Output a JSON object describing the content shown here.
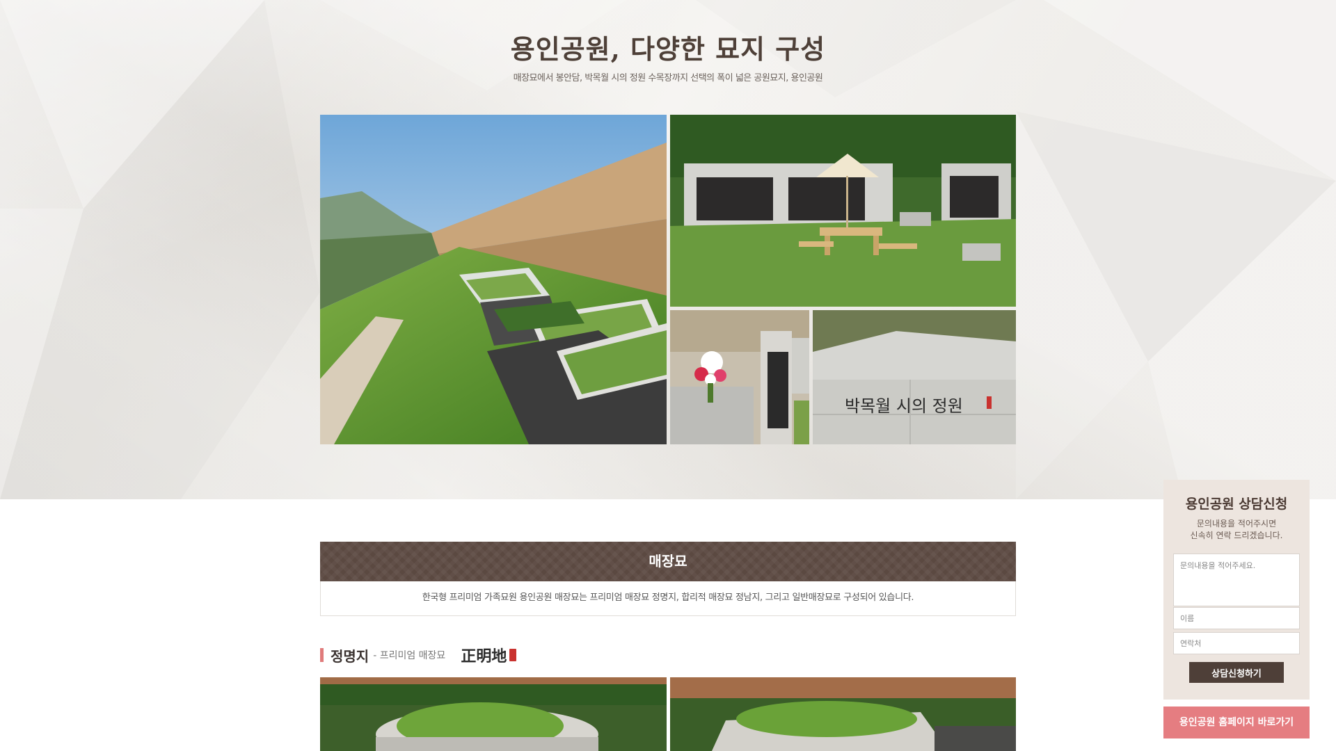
{
  "hero": {
    "title": "용인공원, 다양한 묘지 구성",
    "subtitle": "매장묘에서 봉안담, 박목월 시의 정원 수목장까지 선택의 폭이 넓은 공원묘지, 용인공원",
    "photos": [
      {
        "name": "photo-terraced-graves",
        "caption": ""
      },
      {
        "name": "photo-pavilion-picnic",
        "caption": ""
      },
      {
        "name": "photo-flower-memorial",
        "caption": ""
      },
      {
        "name": "photo-poet-garden-stone",
        "caption": "박목월 시의 정원"
      }
    ]
  },
  "section": {
    "title": "매장묘",
    "description": "한국형 프리미엄 가족묘원 용인공원 매장묘는 프리미엄 매장묘 정명지, 합리적 매장묘 정남지, 그리고 일반매장묘로 구성되어 있습니다.",
    "sub": {
      "title": "정명지",
      "desc": "- 프리미엄 매장묘",
      "hanja": "正明地"
    }
  },
  "consult": {
    "title": "용인공원 상담신청",
    "sub_line1": "문의내용을 적어주시면",
    "sub_line2": "신속히 연락 드리겠습니다.",
    "message_placeholder": "문의내용을 적어주세요.",
    "name_placeholder": "이름",
    "phone_placeholder": "연락처",
    "submit_label": "상담신청하기"
  },
  "homepage_button": "용인공원 홈페이지 바로가기",
  "colors": {
    "hero_bg": "#ece9e4",
    "section_bar": "#5b4941",
    "accent_pink": "#e57d81",
    "button_dark": "#4e3f38",
    "consult_bg": "#ede5df"
  }
}
